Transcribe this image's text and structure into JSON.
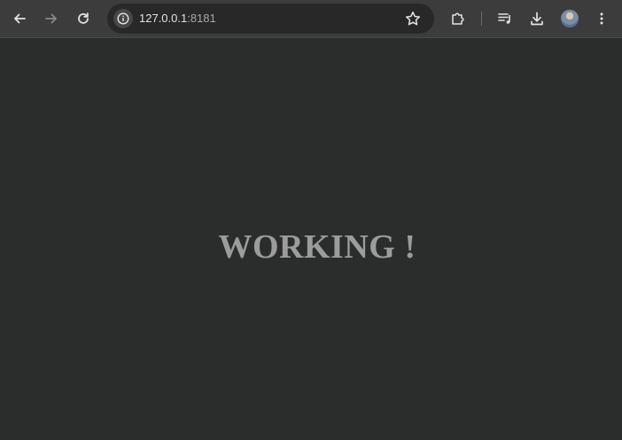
{
  "browser": {
    "url_host": "127.0.0.1",
    "url_port": ":8181",
    "icons": {
      "back": "back-arrow-icon",
      "forward": "forward-arrow-icon",
      "reload": "reload-icon",
      "site_info": "info-icon",
      "bookmark": "star-icon",
      "extensions": "puzzle-icon",
      "media": "media-queue-icon",
      "downloads": "download-icon",
      "profile": "avatar",
      "menu": "kebab-menu-icon"
    },
    "colors": {
      "toolbar": "#3c3c3c",
      "omnibox": "#282828",
      "icon": "#e3e3e3",
      "icon_disabled": "#8a8a8a"
    }
  },
  "page": {
    "heading": "WORKING !",
    "colors": {
      "background": "#2b2d2d",
      "heading": "#9c9c9c"
    }
  }
}
